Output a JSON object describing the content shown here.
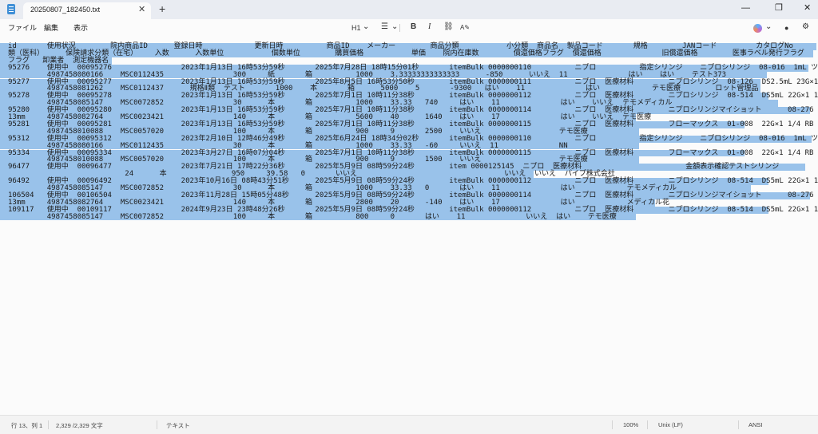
{
  "tab": {
    "title": "20250807_182450.txt",
    "close": "✕",
    "new": "+"
  },
  "window": {
    "minimize": "—",
    "maximize": "❐",
    "close": "✕"
  },
  "menu": {
    "file": "ファイル",
    "edit": "編集",
    "view": "表示"
  },
  "toolbar": {
    "heading": "H1",
    "heading_chevron": "⌄",
    "list": "☰",
    "list_chevron": "⌄",
    "bold": "B",
    "italic": "I",
    "link": "⛓",
    "spell": "A✎",
    "copilot_chevron": "⌄",
    "account": "●",
    "settings": "⚙"
  },
  "lines": [
    "id       使用状況        院内商品ID      登録日時            更新日時          商品ID    メーカー        商品分類           小分類  商品名  製品コード       規格        JANコード         カタログNo       シリアルNo       保険請求分",
    "類（医科）     保険請求分類（在宅）    入数      入数単位           個数単位        購買価格           単価    院内在庫数        償還価格フラグ  償還価格              旧償還価格        医事ラベル発行フラグ      ロット情報入力必須",
    "フラグ   卸業者  測定機器名",
    "95276    使用中  00095276                2023年1月13日 16時53分59秒       2025年7月28日 18時15分01秒       itemBulk 0000000110          ニプロ          指定シリンジ    ニプロシリンジ  08-016  1mL ツベルクリン 26G×1/2SB 針付",
    "         4987458080166    MSC0112435                300     紙       箱          1000    3.33333333333333      -850      いいえ  11              はい    はい    テスト373",
    "95277    使用中  00095277                2023年1月13日 16時53分59秒       2025年8月5日 16時53分50秒        itemBulk 0000000111          ニプロ  医療材料        ニプロシリンジ  08-126  DS2.5mL 23G×1R 針付",
    "         4987458081262    MSC0112437      規格Ⅱ類  テスト       1000    本       箱      5000    5       -9300   はい    11              はい            テモ医療        ロット管理品",
    "95278    使用中  00095278                2023年1月13日 16時53分59秒       2025年7月1日 10時11分38秒        itemBulk 0000000112          ニプロ  医療材料        ニプロシリンジ  08-514  DS5mL 22G×1 1/4R 針付",
    "         4987458085147    MSC0072852                30      本       箱          1000    33.33   740     はい    11              はい    いいえ  テモメディカル",
    "95280    使用中  00095280                2023年1月13日 16時53分59秒       2025年7月1日 10時11分38秒        itemBulk 0000000114          ニプロ  医療材料        ニプロシリンジマイショット      08-276  0.5mL 100U 28G×",
    "13mm     4987458082764    MSC0023421                140     本       箱          5600    40      1640    はい    17              はい    いいえ  テモ医療",
    "95281    使用中  00095281                2023年1月13日 16時53分59秒       2025年7月1日 10時11分38秒        itemBulk 0000000115          ニプロ  医療材料        フローマックス  01-008  22G×1 1/4 RB GA",
    "         4987458010088    MSC0057020                100     本       箱          900     9       2500    いいえ                  テモ医療",
    "95312    使用中  00095312                2023年2月10日 12時46分49秒       2025年6月24日 18時34分02秒       itemBulk 0000000110          ニプロ          指定シリンジ    ニプロシリンジ  08-016  1mL ツベルクリン 26G×1/2SB 針付",
    "         4987458080166    MSC0112435                30      本       箱          1000    33.33   -60     いいえ  11              NN",
    "95334    使用中  00095334                2023年3月27日 16時07分04秒       2025年7月1日 10時11分38秒        itemBulk 0000000115          ニプロ  医療材料        フローマックス  01-008  22G×1 1/4 RB GA",
    "         4987458010088    MSC0057020                100     本       箱          900     9       1500    いいえ                  テモ医療",
    "96477    使用中  00096477                2023年7月21日 17時22分36秒       2025年5月9日 08時59分24秒        item 0000125145  ニプロ  医療材料                        金額表示確認テストシリンジ                      0123456789013",
    "                           24      本               950     39.58   0       いいえ                                  いいえ  いいえ  パイプ株式会社",
    "96492    使用中  00096492                2023年10月16日 08時43分51秒      2025年5月9日 08時59分24秒        itemBulk 0000000112          ニプロ  医療材料        ニプロシリンジ  08-514  DS5mL 22G×1 1/4R 針付",
    "         4987458085147    MSC0072852                30      本       箱          1000    33.33   0       はい    11              はい            テモメディカル",
    "106504   使用中  00106504                2023年11月28日 15時05分48秒      2025年5月9日 08時59分24秒        itemBulk 0000000114          ニプロ  医療材料        ニプロシリンジマイショット      08-276  0.5mL 100U 28G×",
    "13mm     4987458082764    MSC0023421                140     本       箱          2800    20      -140    はい    17              はい            メディカル花",
    "109117   使用中  00109117                2024年9月23日 23時48分26秒       2025年5月9日 08時59分24秒        itemBulk 0000000112          ニプロ  医療材料        ニプロシリンジ  08-514  DS5mL 22G×1 1/4R 針付",
    "         4987458085147    MSC0072852                100     本       箱          800     0       はい    11              いいえ  はい    テモ医療"
  ],
  "status": {
    "position": "行 13、列 1",
    "chars": "2,329 /2,329 文字",
    "format": "テキスト",
    "zoom": "100%",
    "eol": "Unix (LF)",
    "encoding": "ANSI"
  }
}
